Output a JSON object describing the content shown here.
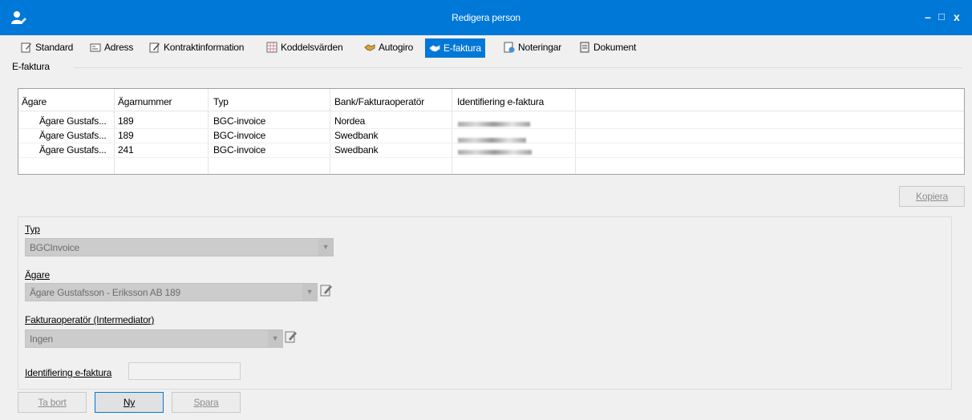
{
  "window": {
    "title": "Redigera person",
    "minimize": "–",
    "maximize": "□",
    "close": "x"
  },
  "tabs": [
    {
      "label": "Standard",
      "icon": "edit-doc-icon"
    },
    {
      "label": "Adress",
      "icon": "address-card-icon"
    },
    {
      "label": "Kontraktinformation",
      "icon": "contract-pen-icon"
    },
    {
      "label": "Koddelsvärden",
      "icon": "grid-table-icon"
    },
    {
      "label": "Autogiro",
      "icon": "handshake-icon"
    },
    {
      "label": "E-faktura",
      "icon": "handshake-icon"
    },
    {
      "label": "Noteringar",
      "icon": "note-clock-icon"
    },
    {
      "label": "Dokument",
      "icon": "document-icon"
    }
  ],
  "active_tab": "E-faktura",
  "group": {
    "legend": "E-faktura"
  },
  "grid": {
    "columns": [
      "Ägare",
      "Ägarnummer",
      "Typ",
      "Bank/Fakturaoperatör",
      "Identifiering e-faktura"
    ],
    "rows": [
      {
        "owner": "Ägare Gustafs...",
        "number": "189",
        "type": "BGC-invoice",
        "bank": "Nordea"
      },
      {
        "owner": "Ägare Gustafs...",
        "number": "189",
        "type": "BGC-invoice",
        "bank": "Swedbank"
      },
      {
        "owner": "Ägare Gustafs...",
        "number": "241",
        "type": "BGC-invoice",
        "bank": "Swedbank"
      }
    ]
  },
  "buttons": {
    "copy": "Kopiera",
    "delete": "Ta bort",
    "new": "Ny",
    "save": "Spara"
  },
  "form": {
    "typ_label": "Typ",
    "typ_value": "BGCInvoice",
    "agare_label": "Ägare",
    "agare_value": "Ägare Gustafsson - Eriksson AB  189",
    "operator_label": "Fakturaoperatör (Intermediator)",
    "operator_value": "Ingen",
    "id_label": "Identifiering e-faktura"
  },
  "colors": {
    "accent": "#0078d7",
    "background": "#f0f0f0",
    "disabled_field": "#cccccc"
  }
}
